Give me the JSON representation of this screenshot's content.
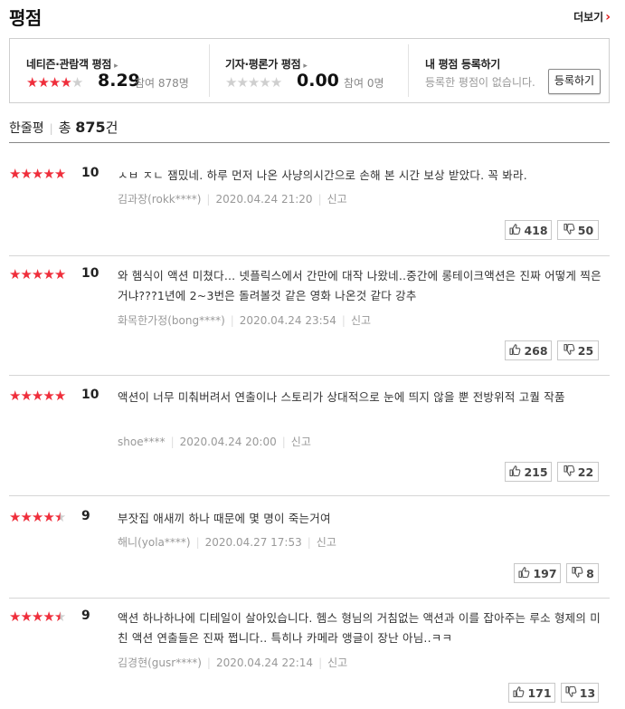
{
  "header": {
    "title": "평점",
    "more_label": "더보기",
    "more_chevron": "›"
  },
  "summary": {
    "audience": {
      "label": "네티즌·관람객 평점",
      "score": "8.29",
      "count": "참여 878명",
      "stars": 4
    },
    "critic": {
      "label": "기자·평론가 평점",
      "score": "0.00",
      "count": "참여 0명",
      "stars": 0
    },
    "mine": {
      "label": "내 평점 등록하기",
      "text": "등록한 평점이 없습니다.",
      "button": "등록하기"
    }
  },
  "line_reviews": {
    "title": "한줄평",
    "total_prefix": "총 ",
    "total_num": "875",
    "total_suffix": "건"
  },
  "reviews": [
    {
      "score": "10",
      "stars": 5,
      "text": "ㅅㅂ ㅈㄴ 잼밌네. 하루 먼저 나온 사냥의시간으로 손해 본 시간 보상 받았다. 꼭 봐라.",
      "user": "김과장(rokk****)",
      "date": "2020.04.24 21:20",
      "report": "신고",
      "up": "418",
      "down": "50"
    },
    {
      "score": "10",
      "stars": 5,
      "text": "와 헴식이 액션 미쳤다... 넷플릭스에서 간만에 대작 나왔네..중간에 롱테이크액션은 진짜 어떻게 찍은거냐???1년에 2~3번은 돌려볼것 같은 영화 나온것 같다 강추",
      "user": "화목한가정(bong****)",
      "date": "2020.04.24 23:54",
      "report": "신고",
      "up": "268",
      "down": "25"
    },
    {
      "score": "10",
      "stars": 5,
      "text": "액션이 너무 미춰버려서 연출이나 스토리가 상대적으로 눈에 띄지 않을 뿐 전방위적 고퀄 작품",
      "user": "shoe****",
      "date": "2020.04.24 20:00",
      "report": "신고",
      "up": "215",
      "down": "22"
    },
    {
      "score": "9",
      "stars": 4.5,
      "text": "부잣집 애새끼 하나 때문에 몇 명이 죽는거여",
      "user": "해니(yola****)",
      "date": "2020.04.27 17:53",
      "report": "신고",
      "up": "197",
      "down": "8"
    },
    {
      "score": "9",
      "stars": 4.5,
      "text": "액션 하나하나에 디테일이 살아있습니다. 헴스 형님의 거침없는 액션과 이를 잡아주는 루소 형제의 미친 액션 연출들은 진짜 쩝니다.. 특히나 카메라 앵글이 장난 아님..ㅋㅋ",
      "user": "김경현(gusr****)",
      "date": "2020.04.24 22:14",
      "report": "신고",
      "up": "171",
      "down": "13"
    }
  ],
  "colors": {
    "star": "#ef2e3b",
    "star_off": "#cfcfcf"
  },
  "icons": {
    "up": "thumbs-up-icon",
    "down": "thumbs-down-icon"
  }
}
